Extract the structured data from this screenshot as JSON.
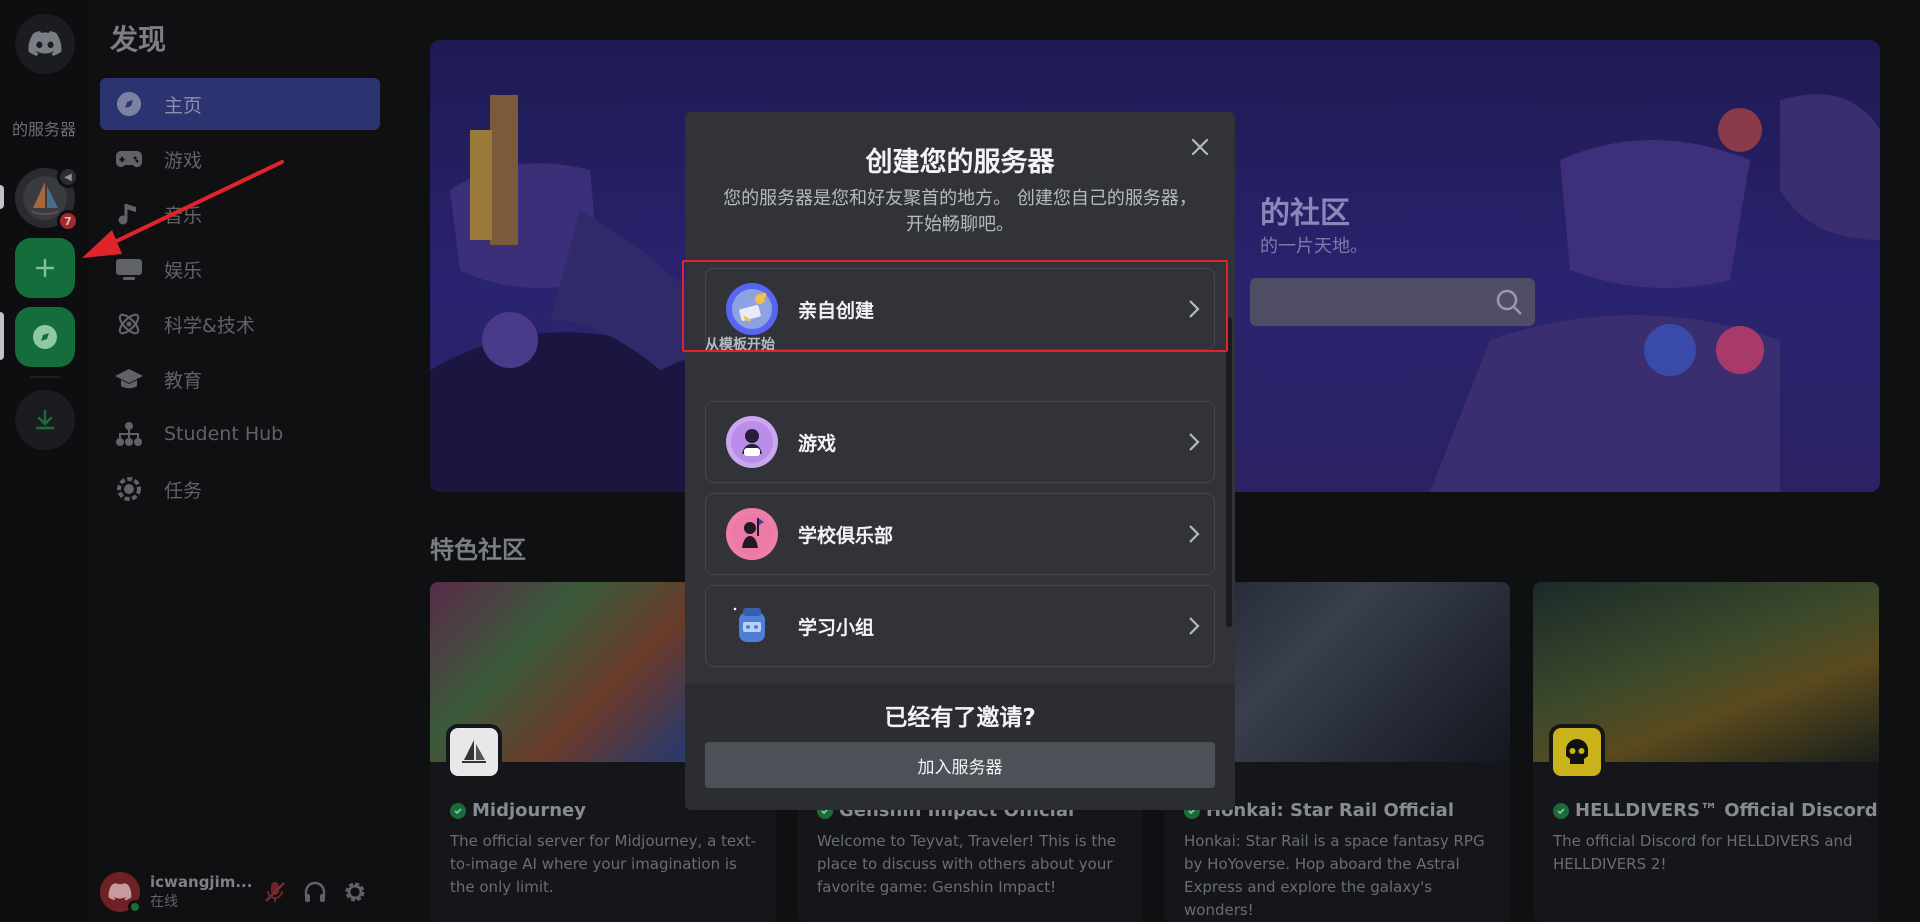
{
  "rail": {
    "server_text": "的服务器",
    "badge_count": "7"
  },
  "nav": {
    "title": "发现",
    "items": [
      {
        "label": "主页",
        "icon": "compass-icon"
      },
      {
        "label": "游戏",
        "icon": "gamepad-icon"
      },
      {
        "label": "音乐",
        "icon": "music-note-icon"
      },
      {
        "label": "娱乐",
        "icon": "tv-icon"
      },
      {
        "label": "科学&技术",
        "icon": "atom-icon"
      },
      {
        "label": "教育",
        "icon": "graduation-cap-icon"
      },
      {
        "label": "Student Hub",
        "icon": "hub-icon"
      },
      {
        "label": "任务",
        "icon": "quest-icon"
      }
    ]
  },
  "user": {
    "name": "icwangjim...",
    "status": "在线"
  },
  "hero": {
    "title": "的社区",
    "subtitle": "的一片天地。"
  },
  "featured": {
    "title": "特色社区",
    "cards": [
      {
        "name": "Midjourney",
        "desc": "The official server for Midjourney, a text-to-image AI where your imagination is the only limit."
      },
      {
        "name": "Genshin Impact Official",
        "desc": "Welcome to Teyvat, Traveler! This is the place to discuss with others about your favorite game: Genshin Impact!"
      },
      {
        "name": "Honkai: Star Rail Official",
        "desc": "Honkai: Star Rail is a space fantasy RPG by HoYoverse. Hop aboard the Astral Express and explore the galaxy's wonders!"
      },
      {
        "name": "HELLDIVERS™ Official Discord",
        "desc": "The official Discord for HELLDIVERS and HELLDIVERS 2!"
      }
    ]
  },
  "modal": {
    "title": "创建您的服务器",
    "subtitle": "您的服务器是您和好友聚首的地方。 创建您自己的服务器，开始畅聊吧。",
    "create_own": "亲自创建",
    "template_section": "从模板开始",
    "templates": [
      "游戏",
      "学校俱乐部",
      "学习小组"
    ],
    "footer_title": "已经有了邀请?",
    "join_button": "加入服务器"
  }
}
